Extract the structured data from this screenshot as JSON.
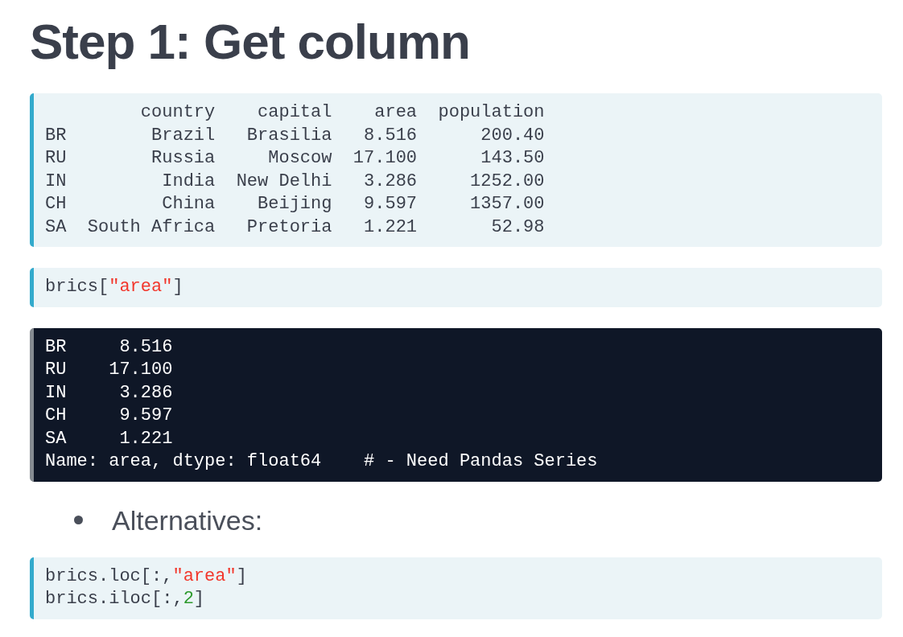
{
  "title": "Step 1: Get column",
  "blocks": [
    {
      "kind": "input",
      "lines": [
        [
          {
            "kind": "plain",
            "text": "         country    capital    area  population"
          }
        ],
        [
          {
            "kind": "plain",
            "text": "BR        Brazil   Brasilia   8.516      200.40"
          }
        ],
        [
          {
            "kind": "plain",
            "text": "RU        Russia     Moscow  17.100      143.50"
          }
        ],
        [
          {
            "kind": "plain",
            "text": "IN         India  New Delhi   3.286     1252.00"
          }
        ],
        [
          {
            "kind": "plain",
            "text": "CH         China    Beijing   9.597     1357.00"
          }
        ],
        [
          {
            "kind": "plain",
            "text": "SA  South Africa   Pretoria   1.221       52.98"
          }
        ]
      ]
    },
    {
      "kind": "input",
      "lines": [
        [
          {
            "kind": "plain",
            "text": "brics["
          },
          {
            "kind": "string",
            "text": "\"area\""
          },
          {
            "kind": "plain",
            "text": "]"
          }
        ]
      ]
    },
    {
      "kind": "output",
      "lines": [
        [
          {
            "kind": "plain",
            "text": "BR     8.516"
          }
        ],
        [
          {
            "kind": "plain",
            "text": "RU    17.100"
          }
        ],
        [
          {
            "kind": "plain",
            "text": "IN     3.286"
          }
        ],
        [
          {
            "kind": "plain",
            "text": "CH     9.597"
          }
        ],
        [
          {
            "kind": "plain",
            "text": "SA     1.221"
          }
        ],
        [
          {
            "kind": "plain",
            "text": "Name: area, dtype: float64    # - Need Pandas Series"
          }
        ]
      ]
    },
    {
      "kind": "bullet",
      "text": "Alternatives:"
    },
    {
      "kind": "input",
      "lines": [
        [
          {
            "kind": "plain",
            "text": "brics.loc[:,"
          },
          {
            "kind": "string",
            "text": "\"area\""
          },
          {
            "kind": "plain",
            "text": "]"
          }
        ],
        [
          {
            "kind": "plain",
            "text": "brics.iloc[:,"
          },
          {
            "kind": "number",
            "text": "2"
          },
          {
            "kind": "plain",
            "text": "]"
          }
        ]
      ]
    }
  ]
}
